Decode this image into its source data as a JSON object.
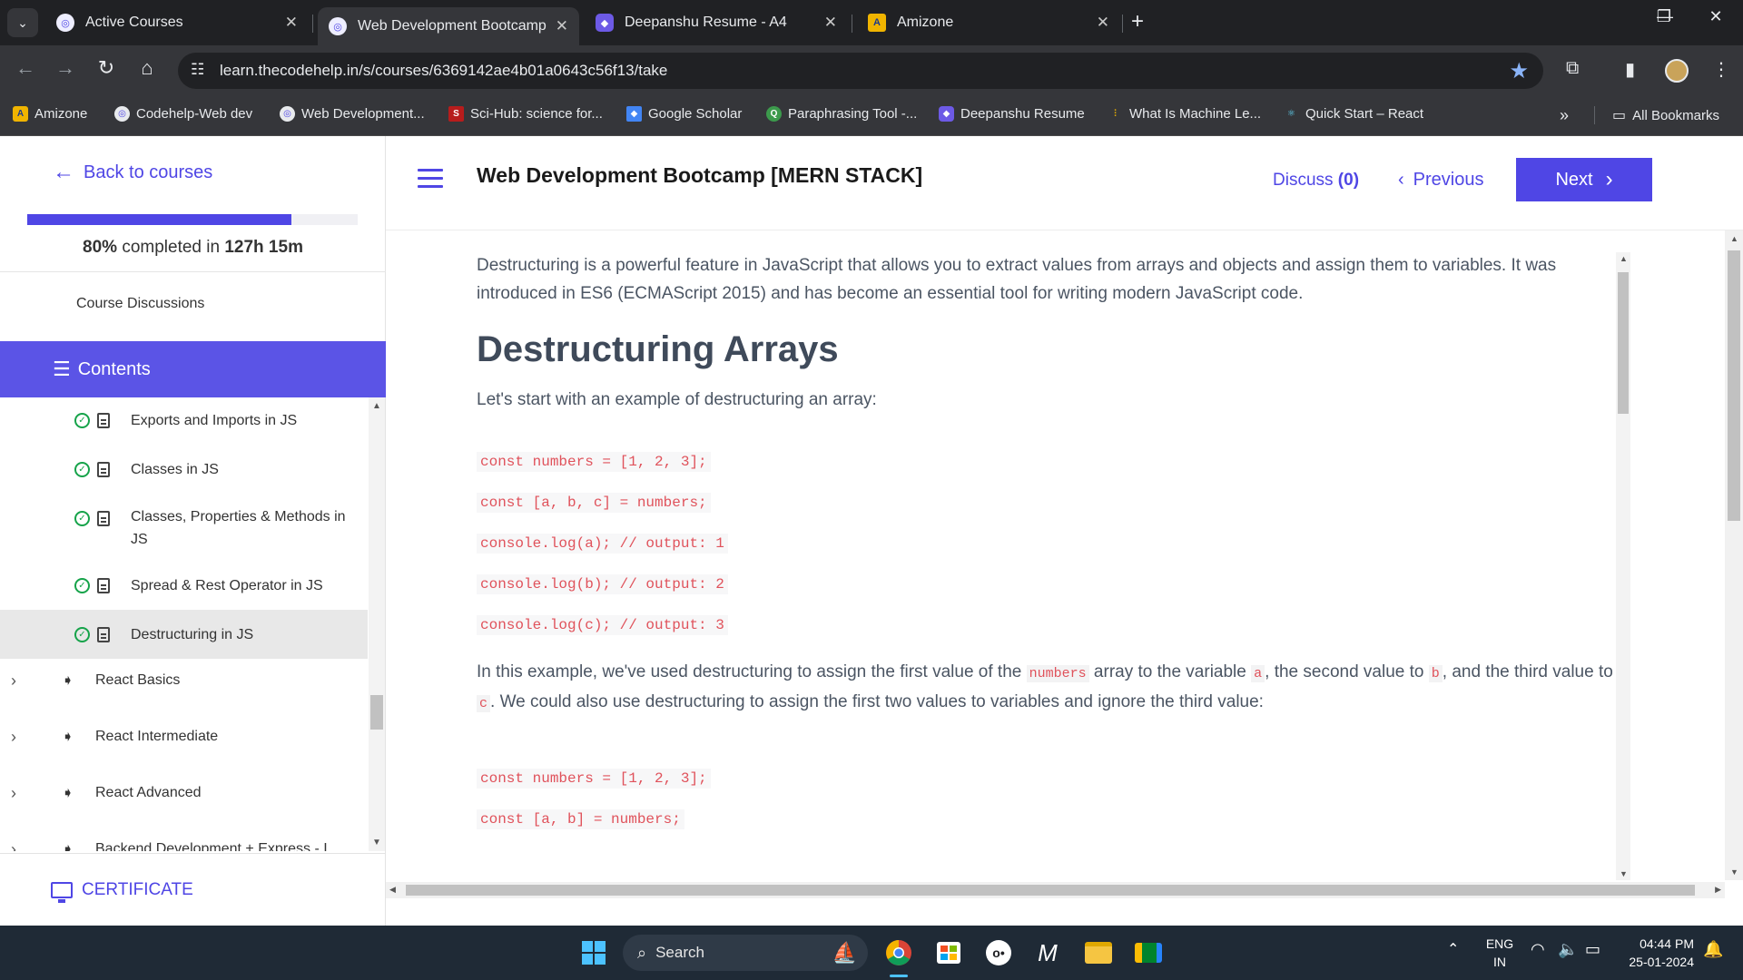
{
  "browser": {
    "tabs": [
      {
        "title": "Active Courses",
        "active": false
      },
      {
        "title": "Web Development Bootcamp [M",
        "active": true
      },
      {
        "title": "Deepanshu Resume - A4",
        "active": false
      },
      {
        "title": "Amizone",
        "active": false
      }
    ],
    "url": "learn.thecodehelp.in/s/courses/6369142ae4b01a0643c56f13/take",
    "bookmarks": [
      "Amizone",
      "Codehelp-Web dev",
      "Web Development...",
      "Sci-Hub: science for...",
      "Google Scholar",
      "Paraphrasing Tool -...",
      "Deepanshu Resume",
      "What Is Machine Le...",
      "Quick Start – React"
    ],
    "all_bookmarks": "All Bookmarks",
    "more_bookmarks": "»"
  },
  "sidebar": {
    "back_label": "Back to courses",
    "progress_percent": 80,
    "progress_pct_text": "80%",
    "progress_mid": " completed in ",
    "progress_time": "127h 15m",
    "course_discussions": "Course Discussions",
    "contents_label": "Contents",
    "lessons": [
      {
        "title": "Exports and Imports in JS",
        "done": true
      },
      {
        "title": "Classes in JS",
        "done": true
      },
      {
        "title": "Classes, Properties & Methods in JS",
        "done": true
      },
      {
        "title": "Spread & Rest Operator in JS",
        "done": true
      },
      {
        "title": "Destructuring in JS",
        "done": true,
        "current": true
      }
    ],
    "sections": [
      "React Basics",
      "React Intermediate",
      "React Advanced",
      "Backend Development + Express - I"
    ],
    "certificate_label": "CERTIFICATE"
  },
  "topbar": {
    "course_title": "Web Development Bootcamp [MERN STACK]",
    "discuss_label": "Discuss ",
    "discuss_count": "(0)",
    "previous_label": "Previous",
    "next_label": "Next"
  },
  "content": {
    "intro": "Destructuring is a powerful feature in JavaScript that allows you to extract values from arrays and objects and assign them to variables. It was introduced in ES6 (ECMAScript 2015) and has become an essential tool for writing modern JavaScript code.",
    "heading": "Destructuring Arrays",
    "lead": "Let's start with an example of destructuring an array:",
    "code1": [
      "const numbers = [1, 2, 3];",
      "const [a, b, c] = numbers;",
      "console.log(a); // output: 1",
      "console.log(b); // output: 2",
      "console.log(c); // output: 3"
    ],
    "explain": {
      "p1": "In this example, we've used destructuring to assign the first value of the ",
      "c1": "numbers",
      "p2": " array to the variable ",
      "c2": "a",
      "p3": ", the second value to ",
      "c3": "b",
      "p4": ", and the third value to ",
      "c4": "c",
      "p5": ". We could also use destructuring to assign the first two values to variables and ignore the third value:"
    },
    "code2": [
      "const numbers = [1, 2, 3];",
      "const [a, b] = numbers;"
    ]
  },
  "taskbar": {
    "search_label": "Search",
    "lang": "ENG",
    "region": "IN",
    "time": "04:44 PM",
    "date": "25-01-2024"
  },
  "colors": {
    "accent": "#4f46e5",
    "code_text": "#e0525b",
    "check_green": "#16a34a"
  }
}
